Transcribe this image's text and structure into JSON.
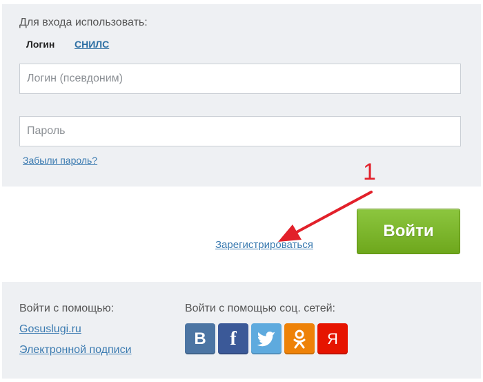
{
  "login_form": {
    "prompt": "Для входа использовать:",
    "tabs": [
      {
        "label": "Логин",
        "active": true
      },
      {
        "label": "СНИЛС",
        "active": false
      }
    ],
    "login_placeholder": "Логин (псевдоним)",
    "password_placeholder": "Пароль",
    "forgot_link": "Забыли пароль?"
  },
  "actions": {
    "register_link": "Зарегистрироваться",
    "login_button": "Войти"
  },
  "annotation": {
    "number": "1",
    "color": "#e2202a"
  },
  "alt_login": {
    "title": "Войти с помощью:",
    "links": [
      "Gosuslugi.ru",
      "Электронной подписи"
    ]
  },
  "social_login": {
    "title": "Войти с помощью соц. сетей:",
    "buttons": [
      {
        "icon": "vk-icon",
        "glyph": "В",
        "color": "#4c75a3"
      },
      {
        "icon": "facebook-icon",
        "glyph": "f",
        "color": "#3b5998"
      },
      {
        "icon": "twitter-icon",
        "glyph": "",
        "color": "#5eaade"
      },
      {
        "icon": "odnoklassniki-icon",
        "glyph": "",
        "color": "#ee8208"
      },
      {
        "icon": "yandex-icon",
        "glyph": "Я",
        "color": "#e61400"
      }
    ]
  },
  "colors": {
    "panel_bg": "#eef0f3",
    "link": "#3a7ab0",
    "button_green": "#7cb82f"
  }
}
